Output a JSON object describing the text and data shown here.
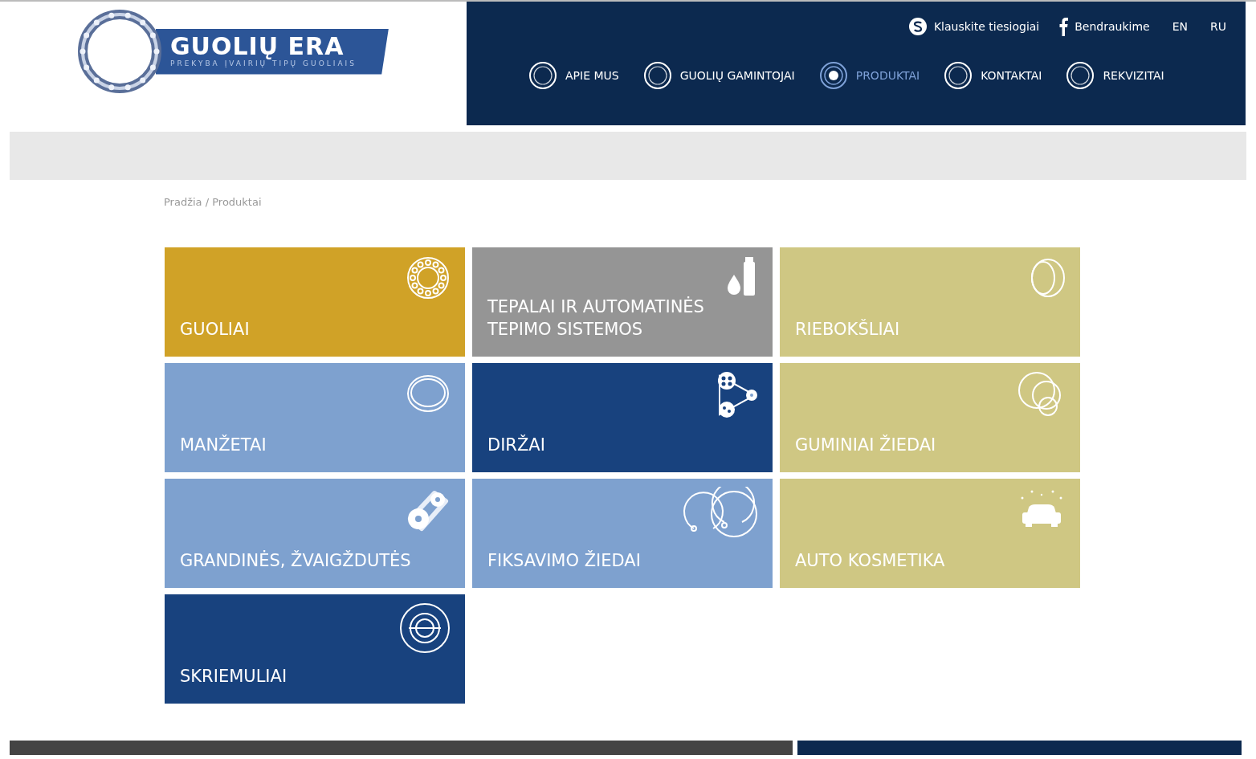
{
  "logo": {
    "title": "GUOLIŲ ERA",
    "tagline": "PREKYBA ĮVAIRIŲ TIPŲ GUOLIAIS"
  },
  "top_links": [
    {
      "kind": "skype",
      "label": "Klauskite tiesiogiai"
    },
    {
      "kind": "facebook",
      "label": "Bendraukime"
    },
    {
      "kind": "lang",
      "label": "EN"
    },
    {
      "kind": "lang",
      "label": "RU"
    }
  ],
  "nav": [
    {
      "label": "APIE MUS",
      "selected": false
    },
    {
      "label": "GUOLIŲ GAMINTOJAI",
      "selected": false
    },
    {
      "label": "PRODUKTAI",
      "selected": true
    },
    {
      "label": "KONTAKTAI",
      "selected": false
    },
    {
      "label": "REKVIZITAI",
      "selected": false
    }
  ],
  "breadcrumb": "Pradžia / Produktai",
  "tiles": [
    {
      "label": "GUOLIAI",
      "color": "#d0a227",
      "kind": "bearing"
    },
    {
      "label": "TEPALAI IR AUTOMATINĖS TEPIMO SISTEMOS",
      "color": "#959595",
      "kind": "oil"
    },
    {
      "label": "RIEBOKŠLIAI",
      "color": "#cfc783",
      "kind": "seal"
    },
    {
      "label": "MANŽETAI",
      "color": "#7ea1cf",
      "kind": "ring"
    },
    {
      "label": "DIRŽAI",
      "color": "#18427e",
      "kind": "belt"
    },
    {
      "label": "GUMINIAI ŽIEDAI",
      "color": "#cfc783",
      "kind": "orings"
    },
    {
      "label": "GRANDINĖS, ŽVAIGŽDUTĖS",
      "color": "#7ea1cf",
      "kind": "gears"
    },
    {
      "label": "FIKSAVIMO ŽIEDAI",
      "color": "#7ea1cf",
      "kind": "circlips"
    },
    {
      "label": "AUTO KOSMETIKA",
      "color": "#cfc783",
      "kind": "car"
    },
    {
      "label": "SKRIEMULIAI",
      "color": "#18427e",
      "kind": "pulley"
    }
  ]
}
